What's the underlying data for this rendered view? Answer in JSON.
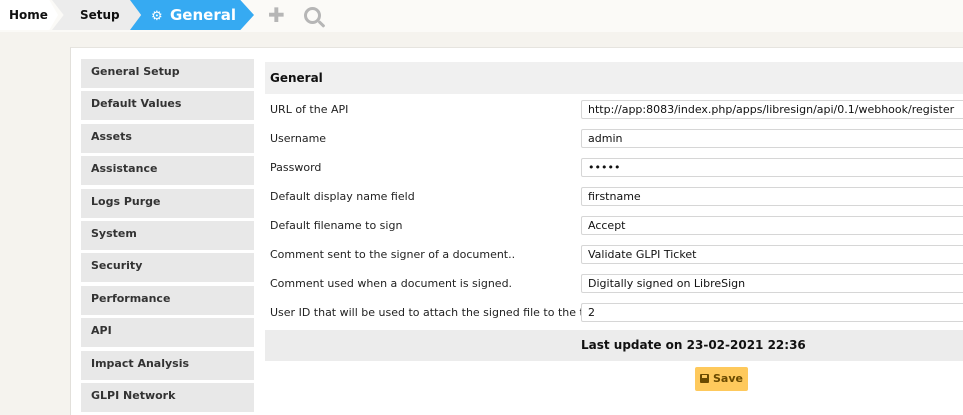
{
  "breadcrumb": {
    "home": "Home",
    "setup": "Setup",
    "current": "General"
  },
  "icons": {
    "gear": "gear-icon",
    "add": "plus-icon",
    "search": "search-icon",
    "save": "floppy-icon"
  },
  "sidebar": {
    "items": [
      {
        "label": "General Setup"
      },
      {
        "label": "Default Values"
      },
      {
        "label": "Assets"
      },
      {
        "label": "Assistance"
      },
      {
        "label": "Logs Purge"
      },
      {
        "label": "System"
      },
      {
        "label": "Security"
      },
      {
        "label": "Performance"
      },
      {
        "label": "API"
      },
      {
        "label": "Impact Analysis"
      },
      {
        "label": "GLPI Network"
      }
    ]
  },
  "form": {
    "title": "General",
    "fields": [
      {
        "label": "URL of the API",
        "value": "http://app:8083/index.php/apps/libresign/api/0.1/webhook/register"
      },
      {
        "label": "Username",
        "value": "admin"
      },
      {
        "label": "Password",
        "value": "•••••"
      },
      {
        "label": "Default display name field",
        "value": "firstname"
      },
      {
        "label": "Default filename to sign",
        "value": "Accept"
      },
      {
        "label": "Comment sent to the signer of a document..",
        "value": "Validate GLPI Ticket"
      },
      {
        "label": "Comment used when a document is signed.",
        "value": "Digitally signed on LibreSign"
      },
      {
        "label": "User ID that will be used to attach the signed file to the ticket.",
        "value": "2"
      }
    ],
    "last_update": "Last update on 23-02-2021 22:36",
    "save_label": "Save"
  },
  "colors": {
    "accent": "#36aaf2",
    "save_button": "#fec95c"
  }
}
